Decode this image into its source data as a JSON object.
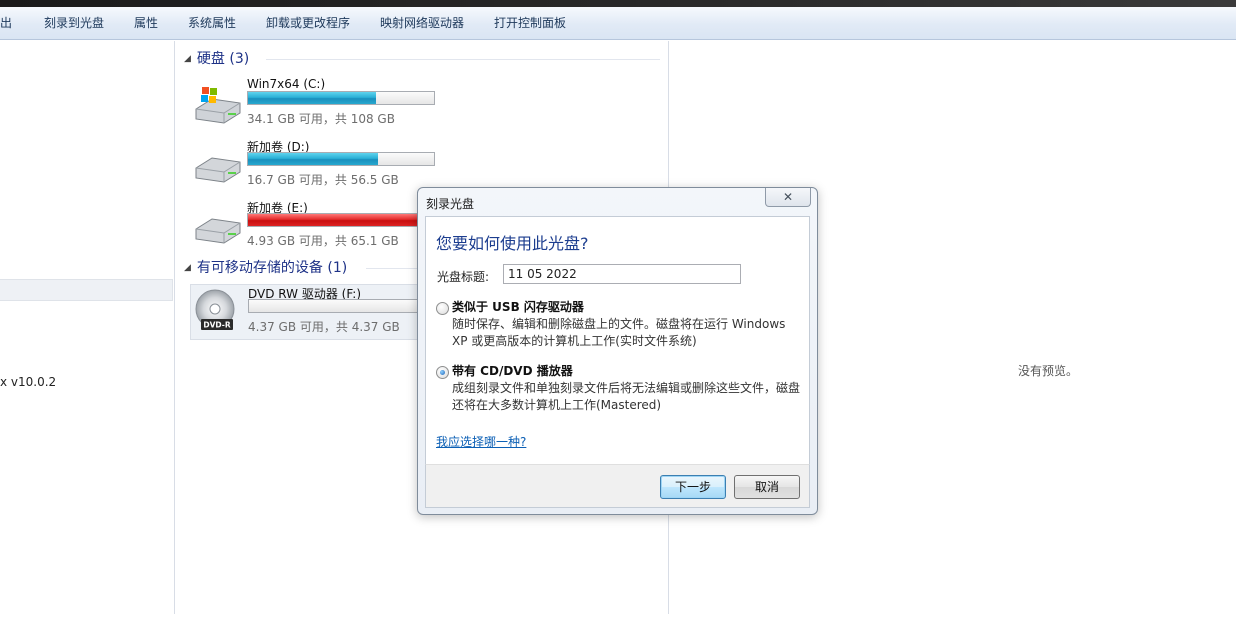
{
  "toolbar": {
    "items": [
      "弹出",
      "刻录到光盘",
      "属性",
      "系统属性",
      "卸载或更改程序",
      "映射网络驱动器",
      "打开控制面板"
    ]
  },
  "nav": {
    "partial_text": "x v10.0.2"
  },
  "groups": {
    "hard_disks": {
      "label": "硬盘 (3)",
      "drives": [
        {
          "name": "Win7x64 (C:)",
          "info": "34.1 GB 可用，共 108 GB",
          "used_fraction": 0.69,
          "status": "normal",
          "icon": "windows-drive-icon"
        },
        {
          "name": "新加卷 (D:)",
          "info": "16.7 GB 可用，共 56.5 GB",
          "used_fraction": 0.7,
          "status": "normal",
          "icon": "hard-drive-icon"
        },
        {
          "name": "新加卷 (E:)",
          "info": "4.93 GB 可用，共 65.1 GB",
          "used_fraction": 0.92,
          "status": "full",
          "icon": "hard-drive-icon"
        }
      ]
    },
    "removable": {
      "label": "有可移动存储的设备 (1)",
      "drives": [
        {
          "name": "DVD RW 驱动器 (F:)",
          "info": "4.37 GB 可用，共 4.37 GB",
          "used_fraction": 0.0,
          "status": "normal",
          "icon": "dvd-disc-icon",
          "icon_badge": "DVD-R"
        }
      ]
    }
  },
  "preview": {
    "message": "没有预览。"
  },
  "dialog": {
    "title": "刻录光盘",
    "close_glyph": "✕",
    "question": "您要如何使用此光盘?",
    "disc_title_label": "光盘标题:",
    "disc_title_value": "11 05 2022",
    "options": [
      {
        "title": "类似于 USB 闪存驱动器",
        "desc": "随时保存、编辑和删除磁盘上的文件。磁盘将在运行 Windows XP 或更高版本的计算机上工作(实时文件系统)",
        "selected": false
      },
      {
        "title": "带有 CD/DVD 播放器",
        "desc": "成组刻录文件和单独刻录文件后将无法编辑或删除这些文件，磁盘还将在大多数计算机上工作(Mastered)",
        "selected": true
      }
    ],
    "help_link": "我应选择哪一种?",
    "next_button": "下一步",
    "cancel_button": "取消"
  }
}
